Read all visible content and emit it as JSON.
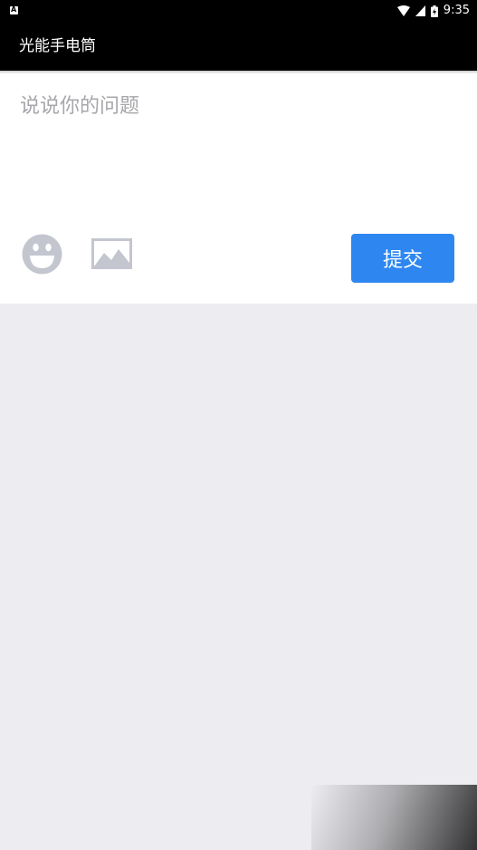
{
  "status_bar": {
    "time": "9:35",
    "icons": [
      "notification-a-icon",
      "wifi-icon",
      "cell-signal-icon",
      "battery-icon"
    ]
  },
  "app_bar": {
    "title": "光能手电筒"
  },
  "composer": {
    "placeholder": "说说你的问题",
    "value": "",
    "emoji_icon": "smiley-face-icon",
    "image_icon": "image-icon",
    "submit_label": "提交"
  },
  "colors": {
    "app_bar": "#000000",
    "background": "#edecf1",
    "composer_bg": "#ffffff",
    "submit_button": "#2e87f0",
    "placeholder": "#a7a7ab",
    "icon_gray": "#c3c6cf"
  }
}
